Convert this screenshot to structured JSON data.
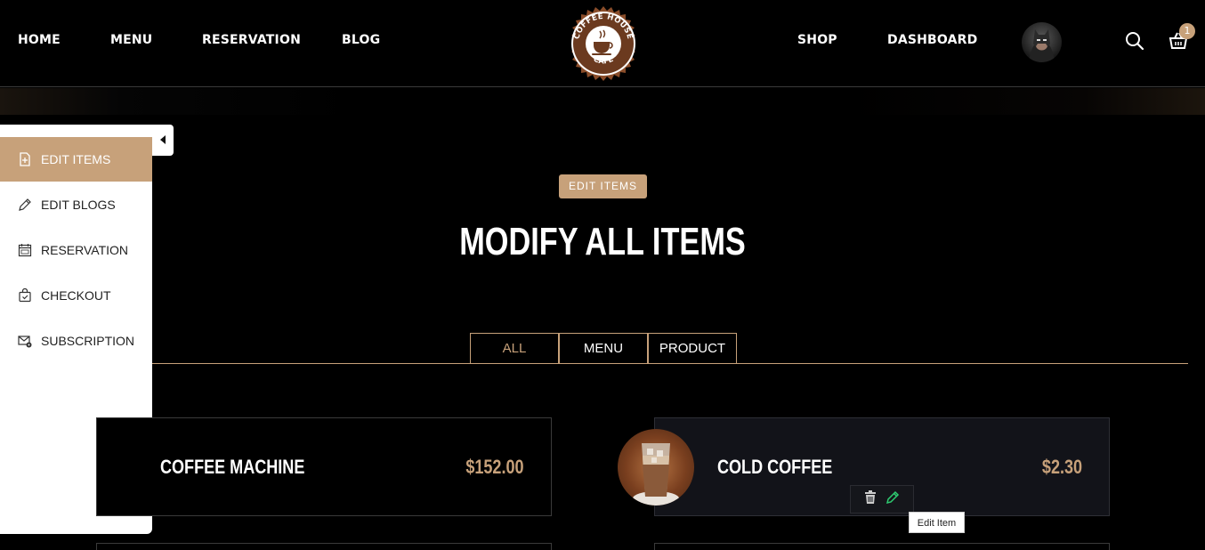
{
  "header": {
    "nav_left": [
      "HOME",
      "MENU",
      "RESERVATION",
      "BLOG"
    ],
    "nav_right": [
      "SHOP",
      "DASHBOARD"
    ],
    "logo_text_top": "COFFEE HOUSE",
    "logo_text_bottom": "CAFE",
    "cart_count": "1",
    "icons": {
      "search": "search-icon",
      "cart": "shopping-basket-icon"
    }
  },
  "sidebar": {
    "items": [
      {
        "label": "EDIT ITEMS",
        "icon": "file-plus-icon",
        "active": true
      },
      {
        "label": "EDIT BLOGS",
        "icon": "pencil-icon"
      },
      {
        "label": "RESERVATION",
        "icon": "calendar-icon"
      },
      {
        "label": "CHECKOUT",
        "icon": "bag-check-icon"
      },
      {
        "label": "SUBSCRIPTION",
        "icon": "mail-gear-icon"
      }
    ]
  },
  "main": {
    "tag": "EDIT ITEMS",
    "title": "MODIFY ALL ITEMS",
    "tabs": [
      {
        "label": "ALL",
        "active": true
      },
      {
        "label": "MENU"
      },
      {
        "label": "PRODUCT"
      }
    ],
    "items": [
      {
        "name": "COFFEE MACHINE",
        "price": "$152.00"
      },
      {
        "name": "COLD COFFEE",
        "price": "$2.30"
      }
    ],
    "tooltip": "Edit Item"
  },
  "colors": {
    "accent": "#c7a17a",
    "edit_icon": "#2ecc71"
  }
}
